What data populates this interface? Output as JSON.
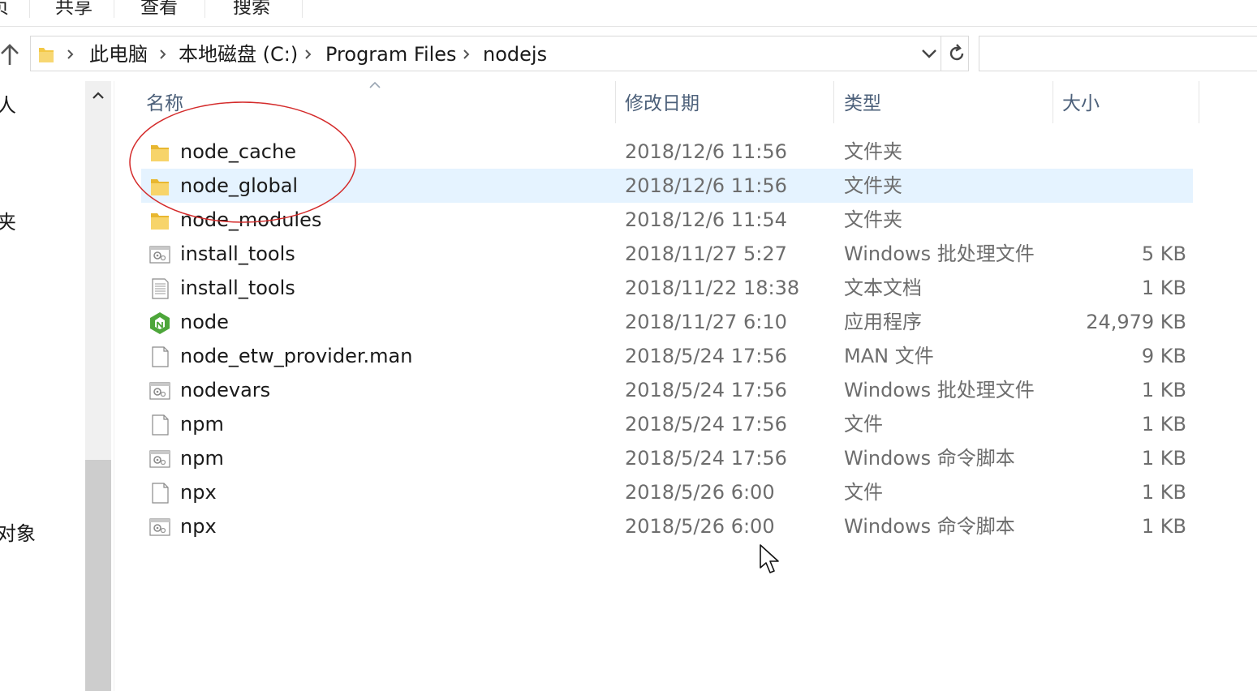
{
  "ribbon": {
    "tab_partial": "页",
    "tabs": [
      "共享",
      "查看",
      "搜索"
    ]
  },
  "address": {
    "crumbs": [
      "此电脑",
      "本地磁盘 (C:)",
      "Program Files",
      "nodejs"
    ],
    "refresh_icon": "refresh-icon",
    "dropdown_icon": "chevron-down-icon"
  },
  "search": {
    "placeholder": ""
  },
  "nav": {
    "items": [
      "人",
      "夹",
      "对象"
    ]
  },
  "columns": {
    "name": "名称",
    "date": "修改日期",
    "type": "类型",
    "size": "大小"
  },
  "files": [
    {
      "name": "node_cache",
      "date": "2018/12/6 11:56",
      "type": "文件夹",
      "size": "",
      "icon": "folder-icon",
      "selected": false
    },
    {
      "name": "node_global",
      "date": "2018/12/6 11:56",
      "type": "文件夹",
      "size": "",
      "icon": "folder-icon",
      "selected": true
    },
    {
      "name": "node_modules",
      "date": "2018/12/6 11:54",
      "type": "文件夹",
      "size": "",
      "icon": "folder-icon",
      "selected": false
    },
    {
      "name": "install_tools",
      "date": "2018/11/27 5:27",
      "type": "Windows 批处理文件",
      "size": "5 KB",
      "icon": "batch-file-icon",
      "selected": false
    },
    {
      "name": "install_tools",
      "date": "2018/11/22 18:38",
      "type": "文本文档",
      "size": "1 KB",
      "icon": "text-file-icon",
      "selected": false
    },
    {
      "name": "node",
      "date": "2018/11/27 6:10",
      "type": "应用程序",
      "size": "24,979 KB",
      "icon": "nodejs-app-icon",
      "selected": false
    },
    {
      "name": "node_etw_provider.man",
      "date": "2018/5/24 17:56",
      "type": "MAN 文件",
      "size": "9 KB",
      "icon": "blank-file-icon",
      "selected": false
    },
    {
      "name": "nodevars",
      "date": "2018/5/24 17:56",
      "type": "Windows 批处理文件",
      "size": "1 KB",
      "icon": "batch-file-icon",
      "selected": false
    },
    {
      "name": "npm",
      "date": "2018/5/24 17:56",
      "type": "文件",
      "size": "1 KB",
      "icon": "blank-file-icon",
      "selected": false
    },
    {
      "name": "npm",
      "date": "2018/5/24 17:56",
      "type": "Windows 命令脚本",
      "size": "1 KB",
      "icon": "batch-file-icon",
      "selected": false
    },
    {
      "name": "npx",
      "date": "2018/5/26 6:00",
      "type": "文件",
      "size": "1 KB",
      "icon": "blank-file-icon",
      "selected": false
    },
    {
      "name": "npx",
      "date": "2018/5/26 6:00",
      "type": "Windows 命令脚本",
      "size": "1 KB",
      "icon": "batch-file-icon",
      "selected": false
    }
  ],
  "colors": {
    "selection": "#e5f3ff",
    "annotation": "#d42b2b",
    "folder": "#f3c845",
    "node_green": "#4da63a"
  }
}
